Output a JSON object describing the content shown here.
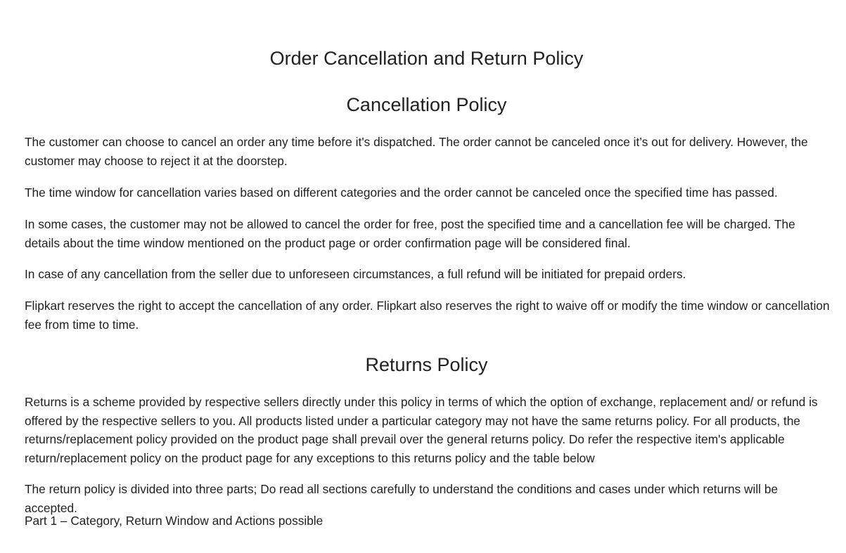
{
  "page": {
    "title": "Order Cancellation and Return Policy"
  },
  "cancellation": {
    "heading": "Cancellation Policy",
    "paragraphs": [
      "The customer can choose to cancel an order any time before it's dispatched. The order cannot be canceled once it’s out for delivery. However, the customer may choose to reject it at the doorstep.",
      "The time window for cancellation varies based on different categories and the order cannot be canceled once the specified time has passed.",
      "In some cases, the customer may not be allowed to cancel the order for free, post the specified time and a cancellation fee will be charged. The details about the time window mentioned on the product page or order confirmation page will be considered final.",
      "In case of any cancellation from the seller due to unforeseen circumstances, a full refund will be initiated for prepaid orders.",
      "Flipkart reserves the right to accept the cancellation of any order. Flipkart also reserves the right to waive off or modify the time window or cancellation fee from time to time."
    ]
  },
  "returns": {
    "heading": "Returns Policy",
    "paragraphs": [
      "Returns is a scheme provided by respective sellers directly under this policy in terms of which the option of exchange, replacement and/ or refund is offered by the respective sellers to you. All products listed under a particular category may not have the same returns policy. For all products, the returns/replacement policy provided on the product page shall prevail over the general returns policy. Do refer the respective item's applicable return/replacement policy on the product page for any exceptions to this returns policy and the table below",
      "The return policy is divided into three parts; Do read all sections carefully to understand the conditions and cases under which returns will be accepted.",
      "Part 1 – Category, Return Window and Actions possible"
    ]
  }
}
